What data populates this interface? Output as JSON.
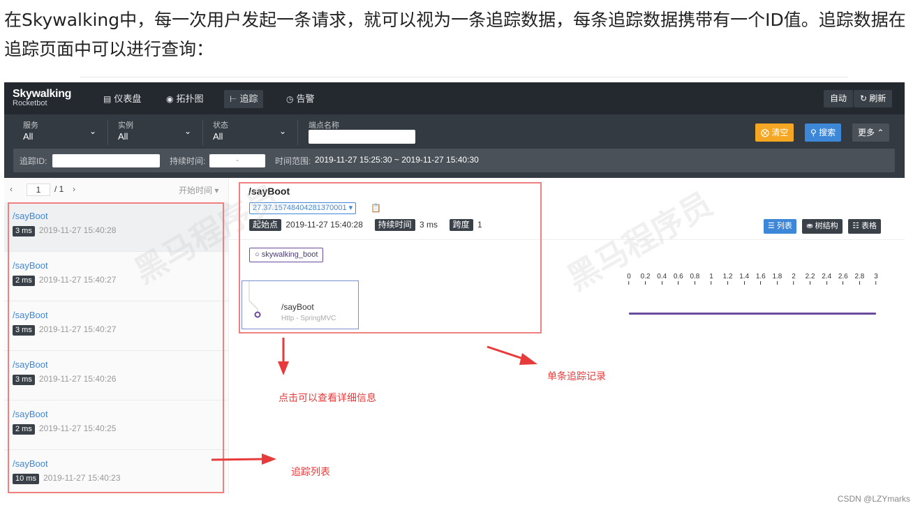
{
  "intro": "在Skywalking中，每一次用户发起一条请求，就可以视为一条追踪数据，每条追踪数据携带有一个ID值。追踪数据在追踪页面中可以进行查询：",
  "app": {
    "logo_title": "Skywalking",
    "logo_subtitle": "Rocketbot",
    "nav": [
      {
        "label": "仪表盘",
        "icon": "dashboard-icon"
      },
      {
        "label": "拓扑图",
        "icon": "topology-icon"
      },
      {
        "label": "追踪",
        "icon": "trace-icon"
      },
      {
        "label": "告警",
        "icon": "alarm-icon"
      }
    ],
    "auto_label": "自动",
    "refresh_label": "刷新"
  },
  "filters": {
    "service": {
      "label": "服务",
      "value": "All"
    },
    "instance": {
      "label": "实例",
      "value": "All"
    },
    "status": {
      "label": "状态",
      "value": "All"
    },
    "endpoint_label": "端点名称",
    "clear_label": "清空",
    "search_label": "搜索",
    "more_label": "更多",
    "trace_id_label": "追踪ID:",
    "duration_label": "持续时间:",
    "duration_sep": "-",
    "time_range_label": "时间范围:",
    "time_range_value": "2019-11-27 15:25:30 ~ 2019-11-27 15:40:30"
  },
  "pager": {
    "current": "1",
    "total": "/ 1",
    "sort_label": "开始时间"
  },
  "traces": [
    {
      "name": "/sayBoot",
      "duration": "3 ms",
      "time": "2019-11-27 15:40:28"
    },
    {
      "name": "/sayBoot",
      "duration": "2 ms",
      "time": "2019-11-27 15:40:27"
    },
    {
      "name": "/sayBoot",
      "duration": "3 ms",
      "time": "2019-11-27 15:40:27"
    },
    {
      "name": "/sayBoot",
      "duration": "3 ms",
      "time": "2019-11-27 15:40:26"
    },
    {
      "name": "/sayBoot",
      "duration": "2 ms",
      "time": "2019-11-27 15:40:25"
    },
    {
      "name": "/sayBoot",
      "duration": "10 ms",
      "time": "2019-11-27 15:40:23"
    }
  ],
  "detail": {
    "title": "/sayBoot",
    "trace_id": "27.37.15748404281370001",
    "start_label": "起始点",
    "start_value": "2019-11-27 15:40:28",
    "duration_label": "持续时间",
    "duration_value": "3 ms",
    "span_label": "跨度",
    "span_value": "1",
    "view_list": "列表",
    "view_tree": "树结构",
    "view_table": "表格",
    "service_tag": "skywalking_boot",
    "node_name": "/sayBoot",
    "node_type": "Http - SpringMVC",
    "axis_ticks": [
      "0",
      "0.2",
      "0.4",
      "0.6",
      "0.8",
      "1",
      "1.2",
      "1.4",
      "1.6",
      "1.8",
      "2",
      "2.2",
      "2.4",
      "2.6",
      "2.8",
      "3"
    ]
  },
  "annotations": {
    "detail_hint": "点击可以查看详细信息",
    "single_record": "单条追踪记录",
    "trace_list": "追踪列表"
  },
  "colors": {
    "accent_blue": "#3d87d8",
    "warning_orange": "#f5a623",
    "annotation_red": "#e83a3a",
    "span_purple": "#6a4a9c"
  },
  "credit": "CSDN @LZYmarks"
}
